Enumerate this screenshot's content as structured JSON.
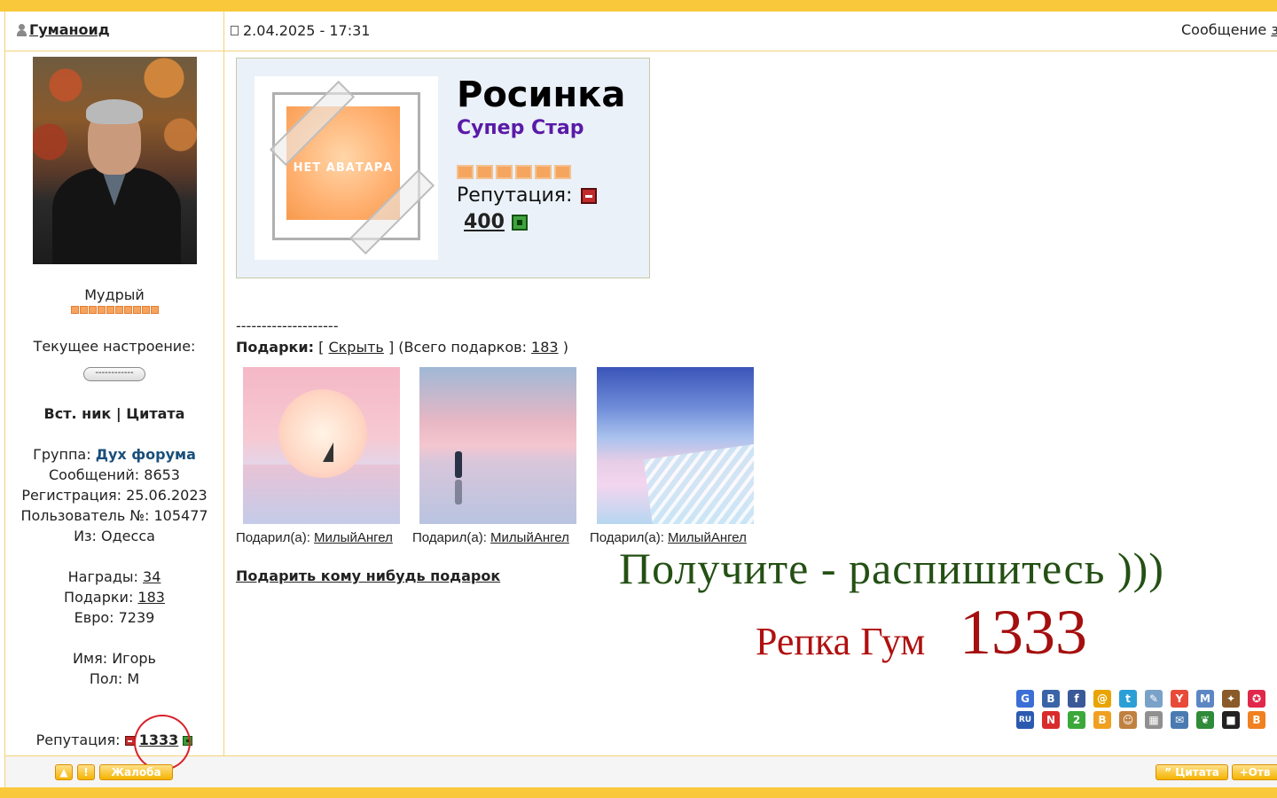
{
  "post": {
    "author": "Гуманоид",
    "date": "2.04.2025 - 17:31",
    "message_label": "Сообщение"
  },
  "profile": {
    "rank": "Мудрый",
    "mood_label": "Текущее настроение:",
    "mood_value": "------------",
    "nick_quote": "Вст. ник | Цитата",
    "group_label": "Группа:",
    "group_value": "Дух форума",
    "posts": "Сообщений: 8653",
    "registered": "Регистрация: 25.06.2023",
    "user_no": "Пользователь №: 105477",
    "from": "Из: Одесса",
    "awards_label": "Награды:",
    "awards_value": "34",
    "gifts_label": "Подарки:",
    "gifts_value": "183",
    "euro": "Евро: 7239",
    "name": "Имя: Игорь",
    "sex": "Пол: М",
    "reputation_label": "Репутация:",
    "reputation_value": "1333"
  },
  "signature": {
    "no_avatar": "НЕТ АВАТАРА",
    "name": "Росинка",
    "rank": "Супер Стар",
    "reputation_label": "Репутация:",
    "reputation_value": "400"
  },
  "gifts": {
    "dashes": "--------------------",
    "label": "Подарки:",
    "open_bracket": "[",
    "hide_link": "Скрыть",
    "close_bracket": "] (Всего подарков:",
    "total": "183",
    "close_paren": ")",
    "items": [
      {
        "gifted_by_label": "Подарил(а):",
        "gifted_by": "МилыйАнгел"
      },
      {
        "gifted_by_label": "Подарил(а):",
        "gifted_by": "МилыйАнгел"
      },
      {
        "gifted_by_label": "Подарил(а):",
        "gifted_by": "МилыйАнгел"
      }
    ],
    "give_link": "Подарить кому нибудь подарок"
  },
  "overlay": {
    "line1": "Получите - распишитесь )))",
    "line2": "Репка Гум",
    "line3": "1333"
  },
  "social_icons": [
    {
      "icon": "google-icon",
      "glyph": "G",
      "color": "#3b6fd6"
    },
    {
      "icon": "bobrdobr-icon",
      "glyph": "B",
      "color": "#3a64a8"
    },
    {
      "icon": "facebook-icon",
      "glyph": "f",
      "color": "#3b5998"
    },
    {
      "icon": "mail-ru-icon",
      "glyph": "@",
      "color": "#e8a400"
    },
    {
      "icon": "twitter-icon",
      "glyph": "t",
      "color": "#2a9fd6"
    },
    {
      "icon": "livejournal-icon",
      "glyph": "✎",
      "color": "#7aa2c9"
    },
    {
      "icon": "yandex-icon",
      "glyph": "Y",
      "color": "#e84a3a"
    },
    {
      "icon": "moimir-icon",
      "glyph": "M",
      "color": "#5d86c4"
    },
    {
      "icon": "memori-icon",
      "glyph": "✦",
      "color": "#8a5a2a"
    },
    {
      "icon": "star-bookmark-icon",
      "glyph": "✪",
      "color": "#e0284a"
    },
    {
      "icon": "rambler-icon",
      "glyph": "RU",
      "color": "#2a5ab0"
    },
    {
      "icon": "news2-icon",
      "glyph": "N",
      "color": "#d92b2b"
    },
    {
      "icon": "two-icon",
      "glyph": "2",
      "color": "#3aa83a"
    },
    {
      "icon": "blogger-icon",
      "glyph": "B",
      "color": "#f0a020"
    },
    {
      "icon": "person-icon",
      "glyph": "☺",
      "color": "#c08040"
    },
    {
      "icon": "grid-icon",
      "glyph": "▦",
      "color": "#909090"
    },
    {
      "icon": "bookmark-icon",
      "glyph": "✉",
      "color": "#4a7ab0"
    },
    {
      "icon": "evernote-icon",
      "glyph": "❦",
      "color": "#2f8a3a"
    },
    {
      "icon": "delicious-icon",
      "glyph": "■",
      "color": "#222222"
    },
    {
      "icon": "b-icon",
      "glyph": "B",
      "color": "#f08020"
    }
  ],
  "footer": {
    "up_icon": "▲",
    "report_label": "Жалоба",
    "quote_label": "Цитата",
    "reply_label": "Отв"
  },
  "colors": {
    "accent": "#f9c93b",
    "group": "#1a4f7a",
    "sig_rank": "#5a1aa8",
    "overlay_green": "#245014",
    "overlay_red": "#b01010"
  }
}
